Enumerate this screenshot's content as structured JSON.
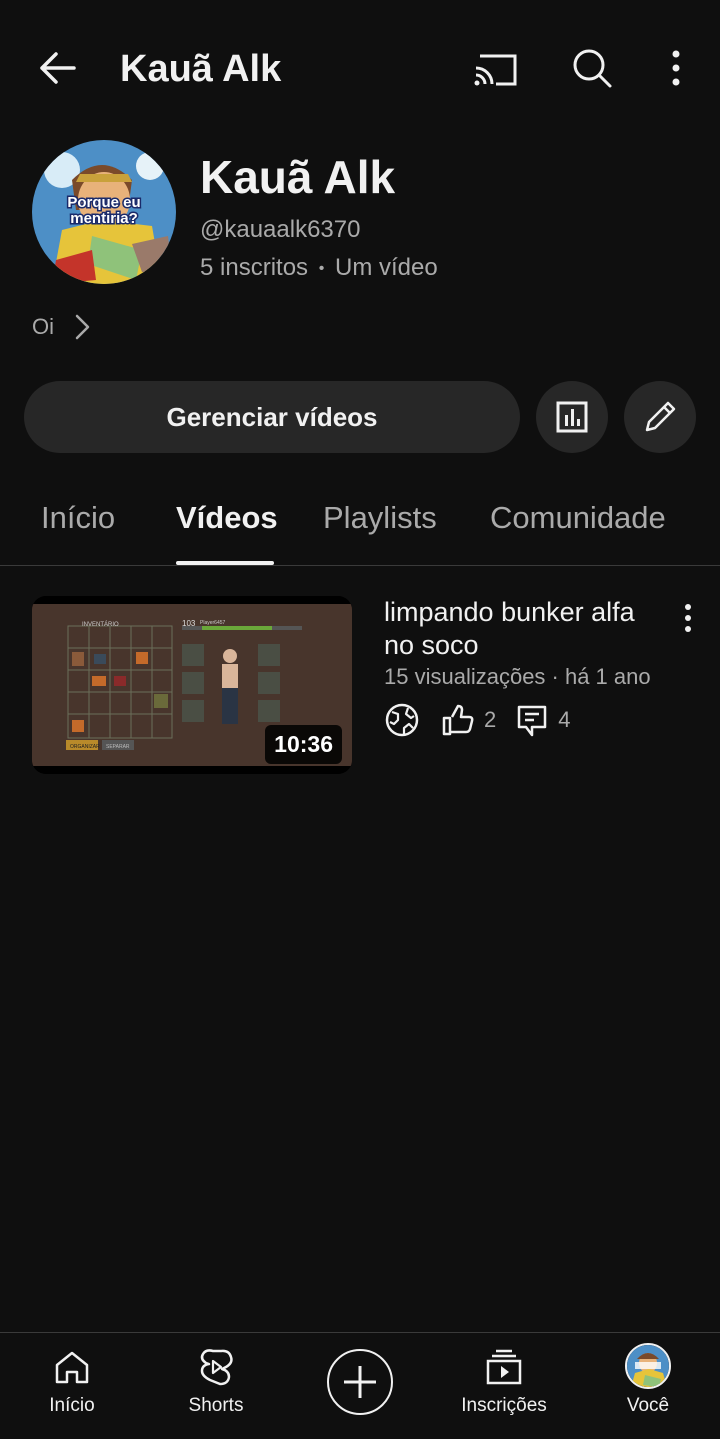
{
  "header": {
    "title": "Kauã Alk",
    "icons": [
      "back-arrow-icon",
      "cast-icon",
      "search-icon",
      "more-vert-icon"
    ]
  },
  "channel": {
    "name": "Kauã Alk",
    "handle": "@kauaalk6370",
    "subscribers": "5 inscritos",
    "separator": "•",
    "video_count": "Um vídeo",
    "description": "Oi",
    "avatar_caption": "Porque eu mentiria?"
  },
  "actions": {
    "manage_label": "Gerenciar vídeos"
  },
  "tabs": [
    {
      "label": "Início",
      "active": false
    },
    {
      "label": "Vídeos",
      "active": true
    },
    {
      "label": "Playlists",
      "active": false
    },
    {
      "label": "Comunidade",
      "active": false
    }
  ],
  "videos": [
    {
      "title": "limpando bunker alfa no soco",
      "views": "15 visualizações · há 1 ano",
      "duration": "10:36",
      "likes": "2",
      "comments": "4",
      "thumbnail_text": {
        "inventory": "INVENTÁRIO",
        "level": "103",
        "player": "Player6457",
        "btn1": "ORGANIZAR",
        "btn2": "SEPARAR"
      }
    }
  ],
  "bottom_nav": [
    {
      "label": "Início",
      "icon": "home-icon"
    },
    {
      "label": "Shorts",
      "icon": "shorts-icon"
    },
    {
      "label": "",
      "icon": "create-plus-icon"
    },
    {
      "label": "Inscrições",
      "icon": "subscriptions-icon"
    },
    {
      "label": "Você",
      "icon": "avatar"
    }
  ],
  "colors": {
    "background": "#0f0f0f",
    "surface": "#272727",
    "text": "#f1f1f1",
    "secondary_text": "#aaaaaa"
  }
}
